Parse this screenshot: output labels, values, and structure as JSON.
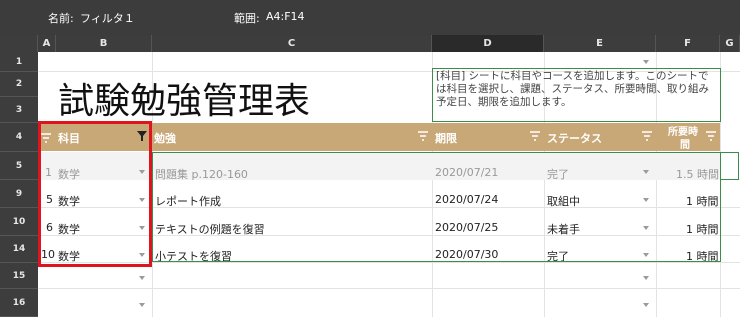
{
  "filter_bar": {
    "name_label": "名前:",
    "name_value": "フィルタ１",
    "range_label": "範囲:",
    "range_value": "A4:F14"
  },
  "columns": [
    "A",
    "B",
    "C",
    "D",
    "E",
    "F",
    "G"
  ],
  "row_numbers": [
    "1",
    "2",
    "3",
    "4",
    "5",
    "9",
    "10",
    "14",
    "15",
    "16"
  ],
  "sheet_title": "試験勉強管理表",
  "note_text": "[科目] シートに科目やコースを追加します。このシートでは科目を選択し、課題、ステータス、所要時間、取り組み予定日、期限を追加します。",
  "headers": {
    "subject": "科目",
    "study": "勉強",
    "deadline": "期限",
    "status": "ステータス",
    "time_l1": "所要時",
    "time_l2": "間"
  },
  "rows": [
    {
      "num": "1",
      "subject": "数学",
      "study": "問題集 p.120-160",
      "deadline": "2020/07/21",
      "status": "完了",
      "time": "1.5 時間"
    },
    {
      "num": "5",
      "subject": "数学",
      "study": "レポート作成",
      "deadline": "2020/07/24",
      "status": "取組中",
      "time": "1 時間"
    },
    {
      "num": "6",
      "subject": "数学",
      "study": "テキストの例題を復習",
      "deadline": "2020/07/25",
      "status": "未着手",
      "time": "1 時間"
    },
    {
      "num": "10",
      "subject": "数学",
      "study": "小テストを復習",
      "deadline": "2020/07/30",
      "status": "完了",
      "time": "1 時間"
    }
  ],
  "colors": {
    "header_bg": "#c9a878",
    "highlight_red": "#e0141e",
    "selection_green": "#3c8c4c",
    "chrome_dark": "#3c3c3c"
  }
}
